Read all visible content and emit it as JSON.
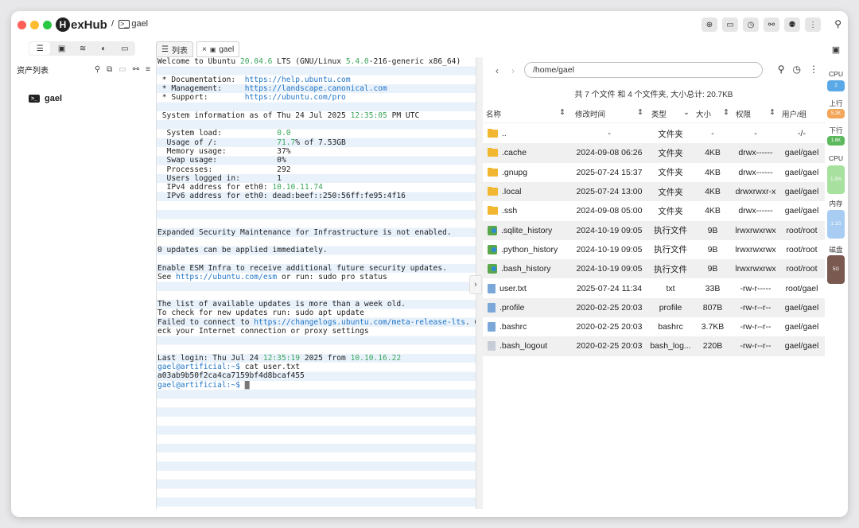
{
  "app": {
    "name_rest": "exHub",
    "logo_letter": "H",
    "breadcrumb_sep": "/",
    "host": "gael"
  },
  "sidebar": {
    "heading": "资产列表",
    "assets": [
      {
        "label": "gael"
      }
    ]
  },
  "tabs": [
    {
      "label": "列表"
    },
    {
      "label": "gael",
      "close": "×"
    }
  ],
  "terminal": {
    "lines": [
      [
        {
          "t": "Welcome to Ubuntu "
        },
        {
          "t": "20.04.6",
          "c": "g"
        },
        {
          "t": " LTS (GNU/Linux "
        },
        {
          "t": "5.4.0",
          "c": "g"
        },
        {
          "t": "-216-generic x86_64)"
        }
      ],
      [],
      [
        {
          "t": " * Documentation:  "
        },
        {
          "t": "https://help.ubuntu.com",
          "c": "b"
        }
      ],
      [
        {
          "t": " * Management:     "
        },
        {
          "t": "https://landscape.canonical.com",
          "c": "b"
        }
      ],
      [
        {
          "t": " * Support:        "
        },
        {
          "t": "https://ubuntu.com/pro",
          "c": "b"
        }
      ],
      [],
      [
        {
          "t": " System information as of Thu 24 Jul 2025 "
        },
        {
          "t": "12:35:05",
          "c": "g"
        },
        {
          "t": " PM UTC"
        }
      ],
      [],
      [
        {
          "t": "  System load:            "
        },
        {
          "t": "0.0",
          "c": "g"
        }
      ],
      [
        {
          "t": "  Usage of /:             "
        },
        {
          "t": "71.7",
          "c": "g"
        },
        {
          "t": "% of 7.53GB"
        }
      ],
      [
        {
          "t": "  Memory usage:           37%"
        }
      ],
      [
        {
          "t": "  Swap usage:             0%"
        }
      ],
      [
        {
          "t": "  Processes:              292"
        }
      ],
      [
        {
          "t": "  Users logged in:        1"
        }
      ],
      [
        {
          "t": "  IPv4 address for eth0: "
        },
        {
          "t": "10.10.11.74",
          "c": "g"
        }
      ],
      [
        {
          "t": "  IPv6 address for eth0: dead:beef::250:56ff:fe95:4f16"
        }
      ],
      [],
      [],
      [],
      [
        {
          "t": "Expanded Security Maintenance for Infrastructure is not enabled."
        }
      ],
      [],
      [
        {
          "t": "0 updates can be applied immediately."
        }
      ],
      [],
      [
        {
          "t": "Enable ESM Infra to receive additional future security updates."
        }
      ],
      [
        {
          "t": "See "
        },
        {
          "t": "https://ubuntu.com/esm",
          "c": "b"
        },
        {
          "t": " or run: sudo pro status"
        }
      ],
      [],
      [],
      [
        {
          "t": "The list of available updates is more than a week old."
        }
      ],
      [
        {
          "t": "To check for new updates run: sudo apt update"
        }
      ],
      [
        {
          "t": "Failed to connect to "
        },
        {
          "t": "https://changelogs.ubuntu.com/meta-release-lts",
          "c": "b"
        },
        {
          "t": ". Ch"
        }
      ],
      [
        {
          "t": "eck your Internet connection or proxy settings"
        }
      ],
      [],
      [],
      [
        {
          "t": "Last login: Thu Jul 24 "
        },
        {
          "t": "12:35:19",
          "c": "g"
        },
        {
          "t": " 2025 from "
        },
        {
          "t": "10.10.16.22",
          "c": "g"
        }
      ],
      [
        {
          "t": "gael@artificial:~$",
          "c": "b"
        },
        {
          "t": " cat user.txt"
        }
      ],
      [
        {
          "t": "a03ab9b50f2ca4ca7159bf4d8bcaf455"
        }
      ],
      [
        {
          "t": "gael@artificial:~$",
          "c": "b"
        },
        {
          "t": " "
        },
        {
          "t": "█",
          "c": "cur"
        }
      ]
    ]
  },
  "filemanager": {
    "path": "/home/gael",
    "summary": "共 7 个文件 和 4 个文件夹, 大小总计: 20.7KB",
    "columns": {
      "name": "名称",
      "mtime": "修改时间",
      "type": "类型",
      "size": "大小",
      "perm": "权限",
      "owner": "用户/组"
    },
    "rows": [
      {
        "icon": "folder",
        "name": "..",
        "mtime": "-",
        "type": "文件夹",
        "size": "-",
        "perm": "-",
        "owner": "-/-"
      },
      {
        "icon": "folder",
        "name": ".cache",
        "mtime": "2024-09-08 06:26",
        "type": "文件夹",
        "size": "4KB",
        "perm": "drwx------",
        "owner": "gael/gael"
      },
      {
        "icon": "folder",
        "name": ".gnupg",
        "mtime": "2025-07-24 15:37",
        "type": "文件夹",
        "size": "4KB",
        "perm": "drwx------",
        "owner": "gael/gael"
      },
      {
        "icon": "folder",
        "name": ".local",
        "mtime": "2025-07-24 13:00",
        "type": "文件夹",
        "size": "4KB",
        "perm": "drwxrwxr-x",
        "owner": "gael/gael"
      },
      {
        "icon": "folder",
        "name": ".ssh",
        "mtime": "2024-09-08 05:00",
        "type": "文件夹",
        "size": "4KB",
        "perm": "drwx------",
        "owner": "gael/gael"
      },
      {
        "icon": "exec",
        "name": ".sqlite_history",
        "mtime": "2024-10-19 09:05",
        "type": "执行文件",
        "size": "9B",
        "perm": "lrwxrwxrwx",
        "owner": "root/root"
      },
      {
        "icon": "exec",
        "name": ".python_history",
        "mtime": "2024-10-19 09:05",
        "type": "执行文件",
        "size": "9B",
        "perm": "lrwxrwxrwx",
        "owner": "root/root"
      },
      {
        "icon": "exec",
        "name": ".bash_history",
        "mtime": "2024-10-19 09:05",
        "type": "执行文件",
        "size": "9B",
        "perm": "lrwxrwxrwx",
        "owner": "root/root"
      },
      {
        "icon": "doc",
        "name": "user.txt",
        "mtime": "2025-07-24 11:34",
        "type": "txt",
        "size": "33B",
        "perm": "-rw-r-----",
        "owner": "root/gael"
      },
      {
        "icon": "doc",
        "name": ".profile",
        "mtime": "2020-02-25 20:03",
        "type": "profile",
        "size": "807B",
        "perm": "-rw-r--r--",
        "owner": "gael/gael"
      },
      {
        "icon": "doc",
        "name": ".bashrc",
        "mtime": "2020-02-25 20:03",
        "type": "bashrc",
        "size": "3.7KB",
        "perm": "-rw-r--r--",
        "owner": "gael/gael"
      },
      {
        "icon": "doc-gray",
        "name": ".bash_logout",
        "mtime": "2020-02-25 20:03",
        "type": "bash_log...",
        "size": "220B",
        "perm": "-rw-r--r--",
        "owner": "gael/gael"
      }
    ]
  },
  "monitor": {
    "items": [
      {
        "label": "CPU",
        "value": "2",
        "color": "#5aa9e6"
      },
      {
        "label": "上行",
        "value": "5.2K",
        "color": "#f2a65a"
      },
      {
        "label": "下行",
        "value": "1.6K",
        "color": "#5cb85c"
      },
      {
        "label": "CPU",
        "value": "1.3%",
        "color": "#a8e0a0"
      },
      {
        "label": "内存",
        "value": "1.1G",
        "color": "#a9cdf2"
      },
      {
        "label": "磁盘",
        "value": "5G",
        "color": "#7a5a50"
      }
    ]
  },
  "colors": {
    "accent": "#1f74c7",
    "term_green": "#3aa55d",
    "folder": "#f2b731"
  }
}
